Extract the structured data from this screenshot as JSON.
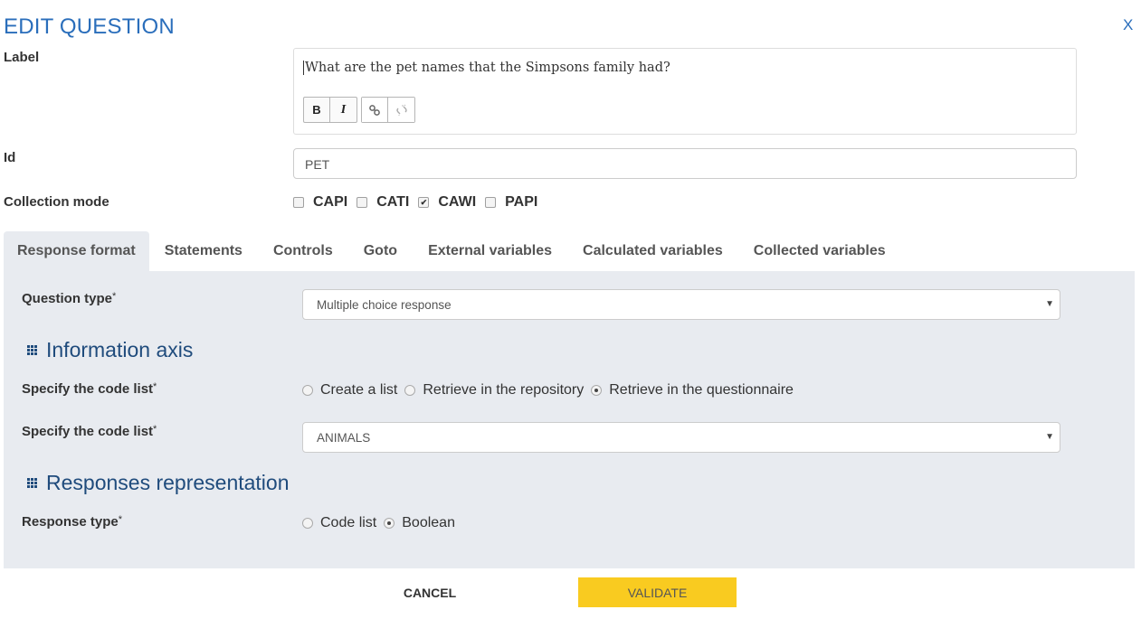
{
  "dialog": {
    "title": "EDIT QUESTION",
    "close_label": "X"
  },
  "label_field": {
    "label": "Label",
    "value": "What are the pet names that the Simpsons family had?",
    "toolbar": {
      "bold": "B",
      "italic": "I",
      "link_icon": "link-icon",
      "unlink_icon": "unlink-icon"
    }
  },
  "id_field": {
    "label": "Id",
    "value": "PET"
  },
  "collection_mode": {
    "label": "Collection mode",
    "options": [
      {
        "label": "CAPI",
        "checked": false
      },
      {
        "label": "CATI",
        "checked": false
      },
      {
        "label": "CAWI",
        "checked": true
      },
      {
        "label": "PAPI",
        "checked": false
      }
    ]
  },
  "tabs": [
    {
      "label": "Response format",
      "active": true
    },
    {
      "label": "Statements",
      "active": false
    },
    {
      "label": "Controls",
      "active": false
    },
    {
      "label": "Goto",
      "active": false
    },
    {
      "label": "External variables",
      "active": false
    },
    {
      "label": "Calculated variables",
      "active": false
    },
    {
      "label": "Collected variables",
      "active": false
    }
  ],
  "response_format": {
    "question_type": {
      "label": "Question type",
      "required_mark": "*",
      "value": "Multiple choice response"
    },
    "information_axis": {
      "heading": "Information axis",
      "code_list_source": {
        "label": "Specify the code list",
        "required_mark": "*",
        "options": [
          {
            "label": "Create a list",
            "selected": false
          },
          {
            "label": "Retrieve in the repository",
            "selected": false
          },
          {
            "label": "Retrieve in the questionnaire",
            "selected": true
          }
        ]
      },
      "code_list": {
        "label": "Specify the code list",
        "required_mark": "*",
        "value": "ANIMALS"
      }
    },
    "responses_representation": {
      "heading": "Responses representation",
      "response_type": {
        "label": "Response type",
        "required_mark": "*",
        "options": [
          {
            "label": "Code list",
            "selected": false
          },
          {
            "label": "Boolean",
            "selected": true
          }
        ]
      }
    }
  },
  "footer": {
    "cancel_label": "CANCEL",
    "validate_label": "VALIDATE",
    "validate_color": "#f9cb20"
  }
}
